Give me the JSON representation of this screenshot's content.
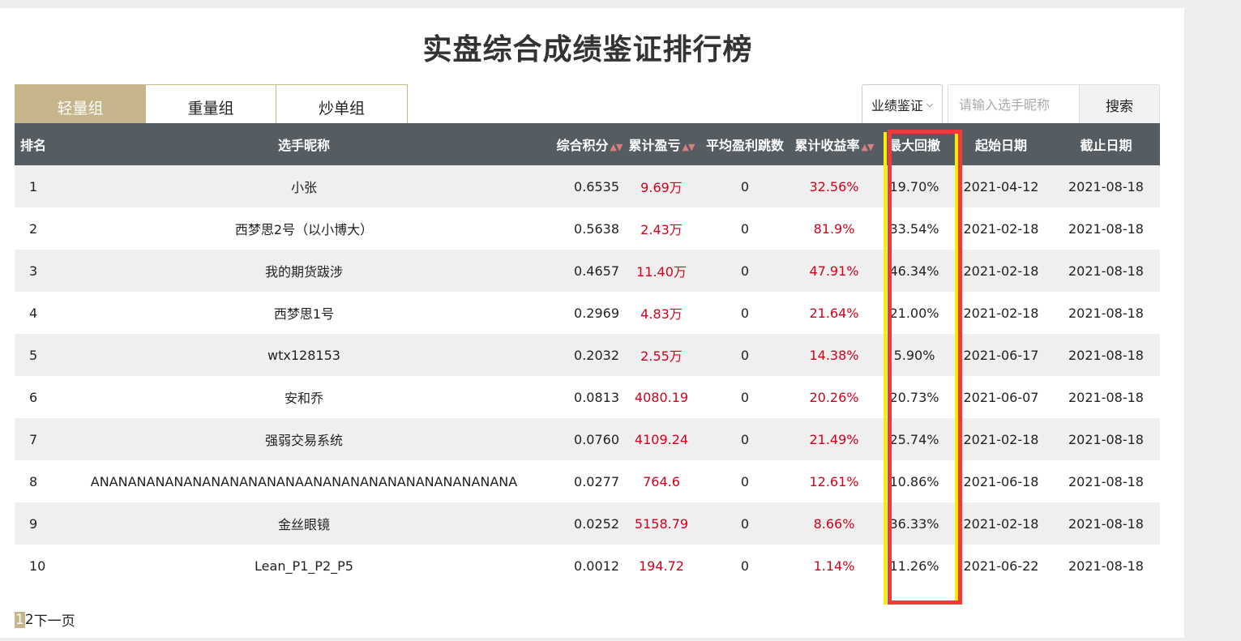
{
  "title": "实盘综合成绩鉴证排行榜",
  "tabs": [
    {
      "label": "轻量组",
      "active": true
    },
    {
      "label": "重量组",
      "active": false
    },
    {
      "label": "炒单组",
      "active": false
    }
  ],
  "search": {
    "select_value": "业绩鉴证",
    "placeholder": "请输入选手昵称",
    "button": "搜索"
  },
  "table": {
    "headers": [
      "排名",
      "选手昵称",
      "综合积分",
      "累计盈亏",
      "平均盈利跳数",
      "累计收益率",
      "最大回撤",
      "起始日期",
      "截止日期"
    ],
    "rows": [
      [
        "1",
        "小张",
        "0.6535",
        "9.69万",
        "0",
        "32.56%",
        "19.70%",
        "2021-04-12",
        "2021-08-18"
      ],
      [
        "2",
        "西梦思2号（以小博大）",
        "0.5638",
        "2.43万",
        "0",
        "81.9%",
        "33.54%",
        "2021-02-18",
        "2021-08-18"
      ],
      [
        "3",
        "我的期货跋涉",
        "0.4657",
        "11.40万",
        "0",
        "47.91%",
        "46.34%",
        "2021-02-18",
        "2021-08-18"
      ],
      [
        "4",
        "西梦思1号",
        "0.2969",
        "4.83万",
        "0",
        "21.64%",
        "21.00%",
        "2021-02-18",
        "2021-08-18"
      ],
      [
        "5",
        "wtx128153",
        "0.2032",
        "2.55万",
        "0",
        "14.38%",
        "5.90%",
        "2021-06-17",
        "2021-08-18"
      ],
      [
        "6",
        "安和乔",
        "0.0813",
        "4080.19",
        "0",
        "20.26%",
        "20.73%",
        "2021-06-07",
        "2021-08-18"
      ],
      [
        "7",
        "强弱交易系统",
        "0.0760",
        "4109.24",
        "0",
        "21.49%",
        "25.74%",
        "2021-02-18",
        "2021-08-18"
      ],
      [
        "8",
        "ANANANANANANANANANANANAANANANANANANANANANANANA",
        "0.0277",
        "764.6",
        "0",
        "12.61%",
        "10.86%",
        "2021-06-18",
        "2021-08-18"
      ],
      [
        "9",
        "金丝眼镜",
        "0.0252",
        "5158.79",
        "0",
        "8.66%",
        "36.33%",
        "2021-02-18",
        "2021-08-18"
      ],
      [
        "10",
        "Lean_P1_P2_P5",
        "0.0012",
        "194.72",
        "0",
        "1.14%",
        "11.26%",
        "2021-06-22",
        "2021-08-18"
      ]
    ]
  },
  "pager": {
    "current": "1",
    "next_page": "2",
    "next_label": "下一页"
  },
  "colors": {
    "accent": "#c6b48a",
    "header_bg": "#555d63",
    "profit": "#d0021b",
    "highlight_red": "#ee3b3b",
    "highlight_yellow": "#f5f000"
  },
  "icons": {
    "sort": "sort-arrows-icon",
    "dropdown": "chevron-down-icon"
  }
}
